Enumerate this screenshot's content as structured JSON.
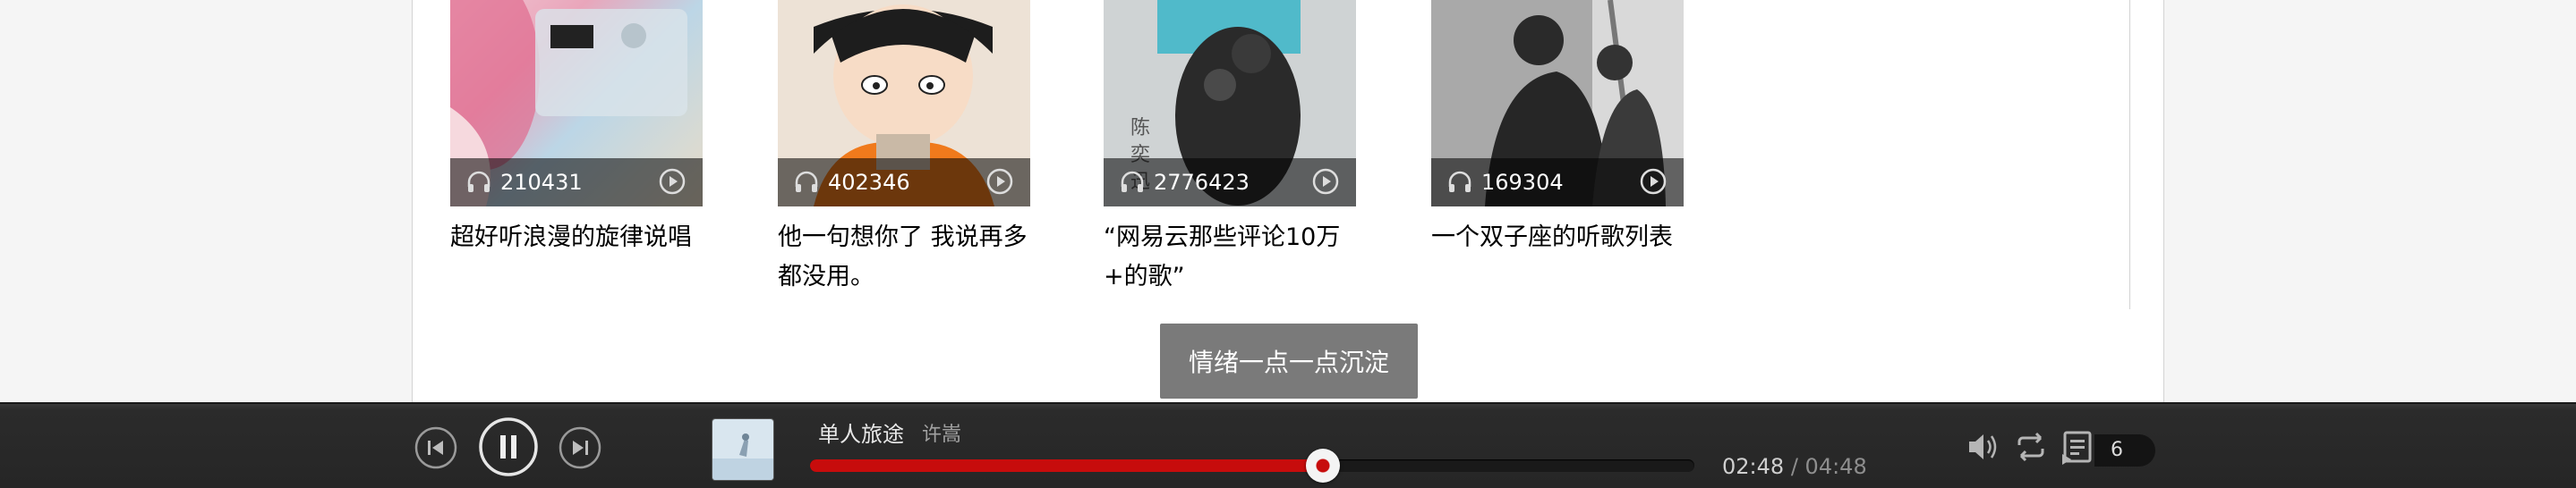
{
  "playlists": [
    {
      "play_count": "210431",
      "title": "超好听浪漫的旋律说唱"
    },
    {
      "play_count": "402346",
      "title": "他一句想你了 我说再多都没用。"
    },
    {
      "play_count": "2776423",
      "title": "“网易云那些评论10万+的歌”"
    },
    {
      "play_count": "169304",
      "title": "一个双子座的听歌列表"
    }
  ],
  "tooltip": {
    "text": "情绪一点一点沉淀"
  },
  "player": {
    "song": "单人旅途",
    "artist": "许嵩",
    "current_time": "02:48",
    "separator": "/",
    "total_time": "04:48",
    "progress_fraction": 0.58,
    "queue_count": "6",
    "colors": {
      "accent": "#c70c0c",
      "bar_bg": "#262626"
    },
    "icons": [
      "prev-icon",
      "pause-icon",
      "next-icon",
      "volume-icon",
      "repeat-icon",
      "playlist-icon"
    ]
  }
}
